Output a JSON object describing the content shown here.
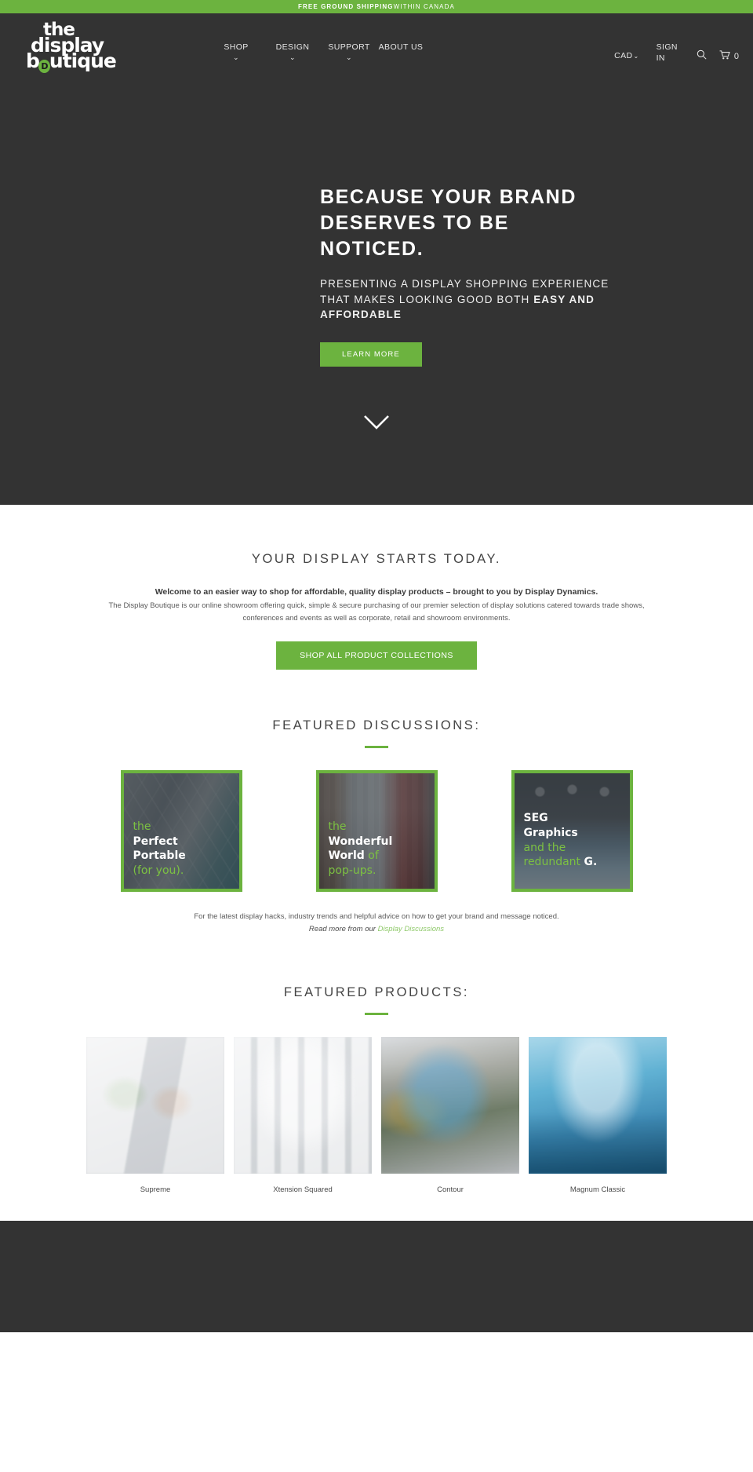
{
  "announcement": {
    "bold_text": "FREE GROUND SHIPPING",
    "thin_text": "WITHIN CANADA",
    "background": "#6cb33f"
  },
  "header": {
    "logo": {
      "line1": "the",
      "line2": "display",
      "line3_before": "b",
      "logo_mark": "D",
      "line3_after": "utique",
      "accent": "#6cb33f"
    },
    "nav": [
      {
        "label": "SHOP",
        "has_dropdown": true
      },
      {
        "label": "DESIGN",
        "has_dropdown": true
      },
      {
        "label": "SUPPORT",
        "has_dropdown": true
      },
      {
        "label": "ABOUT US",
        "has_dropdown": false
      }
    ],
    "currency": {
      "label": "CAD",
      "caret": "⌄"
    },
    "sign_in": "SIGN IN",
    "search_icon": "search-icon",
    "cart": {
      "icon": "cart-icon",
      "count": "0"
    }
  },
  "hero": {
    "title": "BECAUSE YOUR BRAND DESERVES TO BE NOTICED.",
    "subtitle_plain": "PRESENTING A DISPLAY SHOPPING EXPERIENCE THAT MAKES LOOKING GOOD BOTH ",
    "subtitle_bold": "EASY AND AFFORDABLE",
    "cta_label": "LEARN MORE",
    "scroll_icon": "chevron-down-icon",
    "background": "#333333"
  },
  "intro": {
    "title": "YOUR DISPLAY STARTS TODAY.",
    "lead": "Welcome to an easier way to shop for affordable, quality display products – brought to you by Display Dynamics.",
    "body": "The Display Boutique is our online showroom offering quick, simple & secure purchasing of our premier selection of display solutions catered towards trade shows, conferences and events as well as corporate, retail and showroom environments.",
    "cta_label": "SHOP ALL PRODUCT COLLECTIONS"
  },
  "discussions": {
    "title": "FEATURED DISCUSSIONS:",
    "cards": [
      {
        "line1": "the",
        "line2": "Perfect",
        "line3": "Portable",
        "line4": "(for you)."
      },
      {
        "line1": "the",
        "line2": "Wonderful",
        "line3": "World",
        "line3_suffix": "of",
        "line4": "pop-ups."
      },
      {
        "line1": "SEG",
        "line2": "Graphics",
        "line3": "and the",
        "line4": "redundant",
        "line4_suffix": "G."
      }
    ],
    "caption": "For the latest display hacks, industry trends and helpful advice on how to get your brand and message noticed.",
    "readmore_prefix": "Read more from our ",
    "readmore_link": "Display Discussions"
  },
  "products": {
    "title": "FEATURED PRODUCTS:",
    "items": [
      {
        "name": "Supreme"
      },
      {
        "name": "Xtension Squared"
      },
      {
        "name": "Contour"
      },
      {
        "name": "Magnum Classic"
      }
    ]
  },
  "colors": {
    "brand_green": "#6cb33f",
    "dark": "#333333",
    "light_green_link": "#8fc96a"
  }
}
